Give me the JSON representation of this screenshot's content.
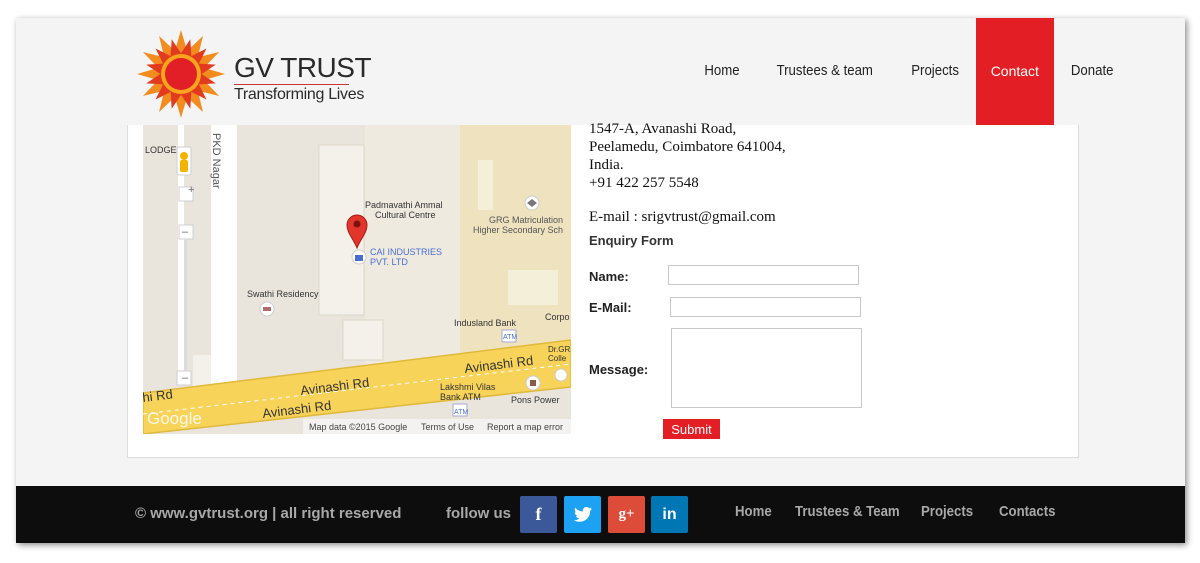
{
  "header": {
    "logo_title": "GV TRUST",
    "logo_tagline": "Transforming Lives",
    "nav": [
      {
        "label": "Home"
      },
      {
        "label": "Trustees & team"
      },
      {
        "label": "Projects"
      },
      {
        "label": "Contact",
        "active": true
      },
      {
        "label": "Donate"
      }
    ]
  },
  "map": {
    "labels": {
      "lodge": "LODGE",
      "pkd_nagar": "PKD Nagar",
      "padmavathi": "Padmavathi Ammal",
      "padmavathi2": "Cultural Centre",
      "grg1": "GRG Matriculation",
      "grg2": "Higher Secondary Sch",
      "cai1": "CAI INDUSTRIES",
      "cai2": "PVT. LTD",
      "swathi": "Swathi Residency",
      "indusland": "Indusland Bank",
      "corp": "Corpo",
      "atm": "ATM",
      "drgr1": "Dr.GR",
      "drgr2": "Colle",
      "avinashi_upper": "Avinashi Rd",
      "avinashi_mid": "Avinashi Rd",
      "avinashi_lower": "Avinashi Rd",
      "hi_rd": "hi Rd",
      "lakshmi1": "Lakshmi Vilas",
      "lakshmi2": "Bank ATM",
      "pons": "Pons Power",
      "atm2": "ATM",
      "google": "Google",
      "map_data": "Map data ©2015 Google",
      "terms": "Terms of Use",
      "report": "Report a map error",
      "zoom_in": "+",
      "zoom_out": "–"
    }
  },
  "address": {
    "line1": "1547-A, Avanashi Road,",
    "line2": "Peelamedu, Coimbatore 641004,",
    "line3": "India.",
    "phone": "+91 422 257 5548",
    "email": "E-mail : srigvtrust@gmail.com"
  },
  "form": {
    "title": "Enquiry Form",
    "name_label": "Name:",
    "email_label": "E-Mail:",
    "message_label": "Message:",
    "submit_label": "Submit",
    "name_value": "",
    "email_value": "",
    "message_value": ""
  },
  "footer": {
    "copyright": "© www.gvtrust.org | all right reserved",
    "follow": "follow us",
    "social": [
      {
        "glyph": "f",
        "name": "facebook",
        "color": "#3b5998"
      },
      {
        "glyph": "t",
        "name": "twitter",
        "color": "#1da1f2"
      },
      {
        "glyph": "g+",
        "name": "google-plus",
        "color": "#dd4b39"
      },
      {
        "glyph": "in",
        "name": "linkedin",
        "color": "#0077b5"
      }
    ],
    "nav": [
      {
        "label": "Home"
      },
      {
        "label": "Trustees & Team"
      },
      {
        "label": "Projects"
      },
      {
        "label": "Contacts"
      }
    ]
  },
  "colors": {
    "accent": "#e31e24",
    "footer_bg": "#0d0d0d",
    "road": "#f5d76e"
  }
}
